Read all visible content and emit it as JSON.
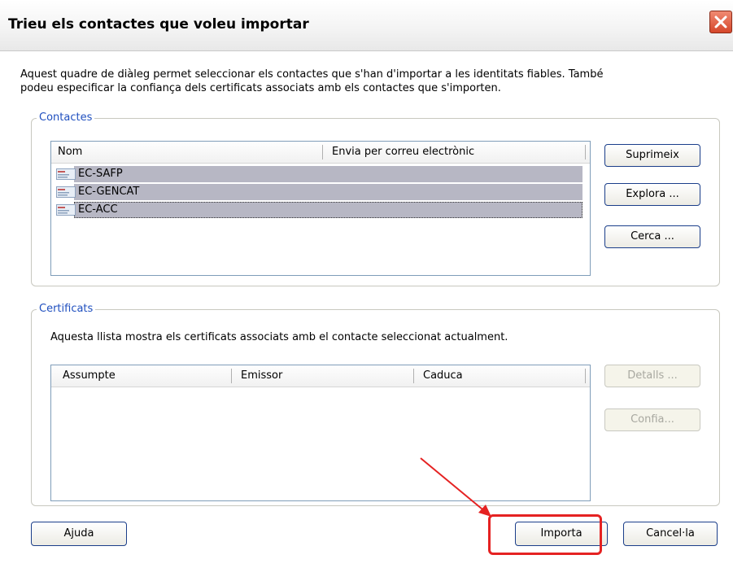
{
  "window": {
    "title": "Trieu els contactes que voleu importar",
    "close_icon": "close-icon"
  },
  "intro": {
    "line1": "Aquest quadre de diàleg permet seleccionar els contactes que s'han d'importar a les identitats fiables. També",
    "line2": "podeu especificar la confiança dels certificats associats amb els contactes que s'importen."
  },
  "contacts": {
    "legend": "Contactes",
    "columns": [
      "Nom",
      "Envia per correu electrònic"
    ],
    "rows": [
      {
        "name": "EC-SAFP",
        "icon": "certificate-contact-icon"
      },
      {
        "name": "EC-GENCAT",
        "icon": "certificate-contact-icon"
      },
      {
        "name": "EC-ACC",
        "icon": "certificate-contact-icon"
      }
    ],
    "buttons": {
      "remove": "Suprimeix",
      "browse": "Explora ...",
      "search": "Cerca ..."
    }
  },
  "certificates": {
    "legend": "Certificats",
    "description": "Aquesta llista mostra els certificats associats amb el contacte seleccionat actualment.",
    "columns": [
      "Assumpte",
      "Emissor",
      "Caduca"
    ],
    "buttons": {
      "details": "Detalls ...",
      "trust": "Confia..."
    }
  },
  "footer": {
    "help": "Ajuda",
    "import": "Importa",
    "cancel": "Cancel·la"
  },
  "colors": {
    "selection": "#b7b7c4",
    "legend": "#1f4fbf",
    "annotation": "#e52222"
  }
}
